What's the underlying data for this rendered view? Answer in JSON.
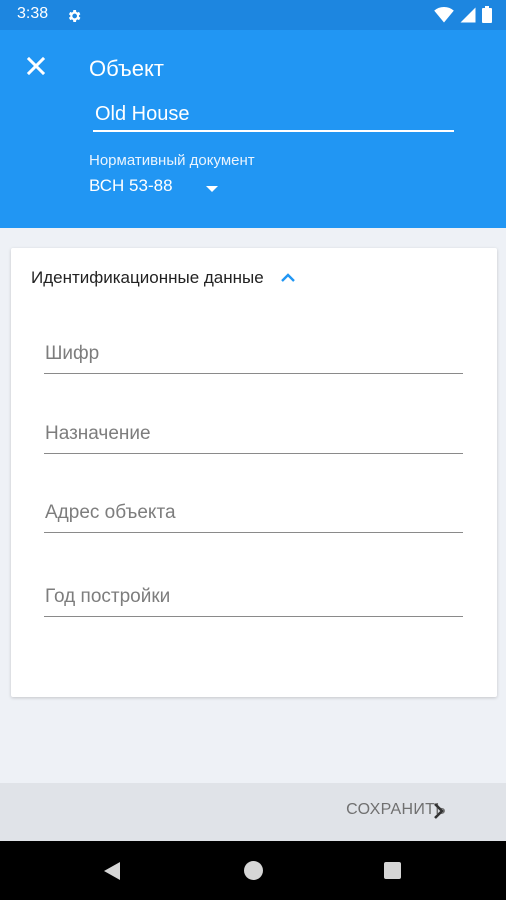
{
  "status_bar": {
    "time": "3:38",
    "icons": [
      "gear-icon",
      "wifi-icon",
      "signal-icon",
      "battery-icon"
    ]
  },
  "app_bar": {
    "title": "Объект",
    "name_value": "Old House",
    "doc_label": "Нормативный документ",
    "doc_value": "ВСН 53-88",
    "background": "#2196f3"
  },
  "card": {
    "title": "Идентификационные данные",
    "fields": [
      {
        "placeholder": "Шифр"
      },
      {
        "placeholder": "Назначение"
      },
      {
        "placeholder": "Адрес объекта"
      },
      {
        "placeholder": "Год постройки"
      }
    ]
  },
  "bottom_bar": {
    "save_label": "СОХРАНИТЬ"
  }
}
